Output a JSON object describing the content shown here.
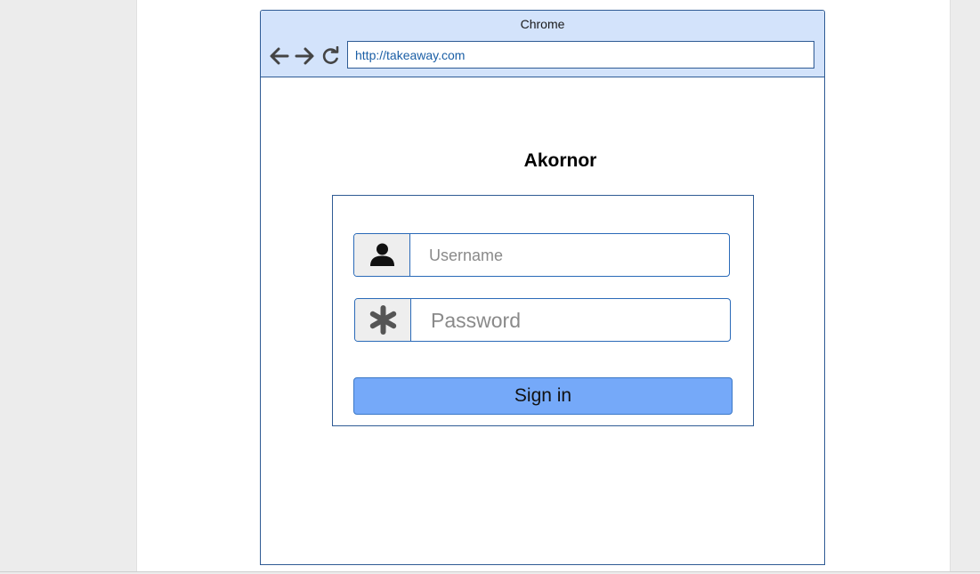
{
  "browser": {
    "title": "Chrome",
    "url": "http://takeaway.com",
    "icons": [
      "back-arrow-icon",
      "forward-arrow-icon",
      "reload-icon"
    ]
  },
  "page": {
    "title": "Akornor"
  },
  "login": {
    "username_placeholder": "Username",
    "password_placeholder": "Password",
    "signin_label": "Sign in",
    "icons": [
      "user-icon",
      "asterisk-icon"
    ]
  },
  "colors": {
    "chrome_bar": "#d3e3fb",
    "border": "#2f5b94",
    "url_text": "#1b5fa6",
    "button": "#75a9f9",
    "addon_bg": "#eeeeee"
  }
}
